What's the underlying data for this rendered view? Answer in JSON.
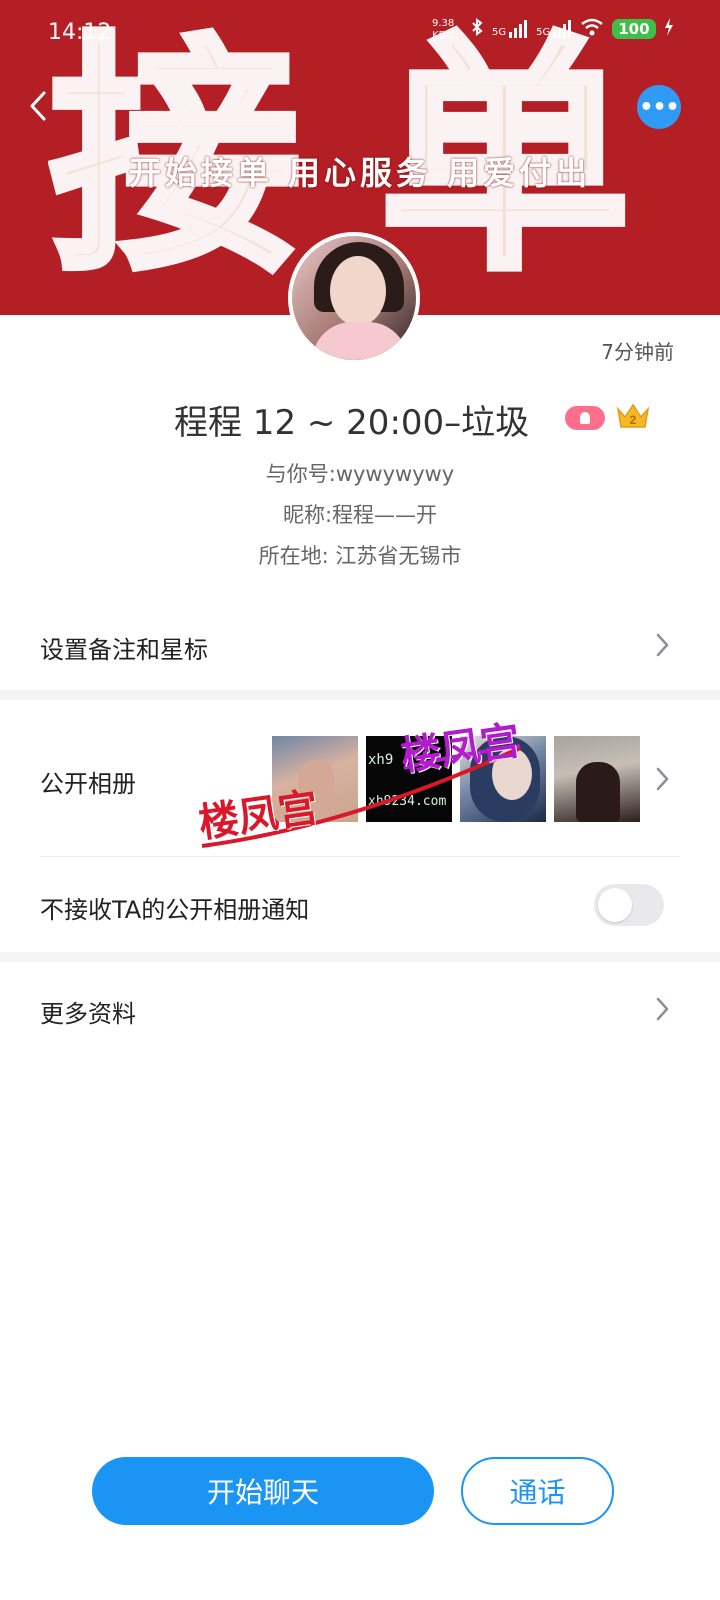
{
  "status_bar": {
    "time": "14:12",
    "net_speed": "9.38",
    "net_unit": "KB/s",
    "bluetooth_icon": "bluetooth-icon",
    "signal_1": "5G",
    "signal_2": "5G",
    "wifi_icon": "wifi-icon",
    "battery": "100",
    "charging_icon": "lightning-icon"
  },
  "header": {
    "banner_glyph_left": "接",
    "banner_glyph_right": "单",
    "banner_slogan": "开始接单 用心服务 用爱付出",
    "back_icon": "chevron-left-icon",
    "more_icon": "ellipsis-icon",
    "more_glyph": "•••"
  },
  "profile": {
    "last_active": "7分钟前",
    "display_name": "程程 12 ~ 20:00–垃圾",
    "badge_icon": "person-badge-icon",
    "crown_level": "2",
    "account": "与你号:wywywywy",
    "nickname": "昵称:程程——开",
    "location": "所在地: 江苏省无锡市"
  },
  "menu": {
    "remark_label": "设置备注和星标",
    "album_label": "公开相册",
    "notify_label": "不接收TA的公开相册通知",
    "notify_enabled": false,
    "more_label": "更多资料"
  },
  "album": {
    "thumb2_text_a": "xh9",
    "thumb2_text_b": "xh9234.com",
    "watermark_1": "楼凤宫",
    "watermark_2": "楼凤宫"
  },
  "actions": {
    "chat_label": "开始聊天",
    "call_label": "通话"
  },
  "colors": {
    "banner_red": "#b31f24",
    "accent_blue": "#1b95f4",
    "badge_pink": "#ff6f8c",
    "crown_gold": "#f5b928"
  }
}
